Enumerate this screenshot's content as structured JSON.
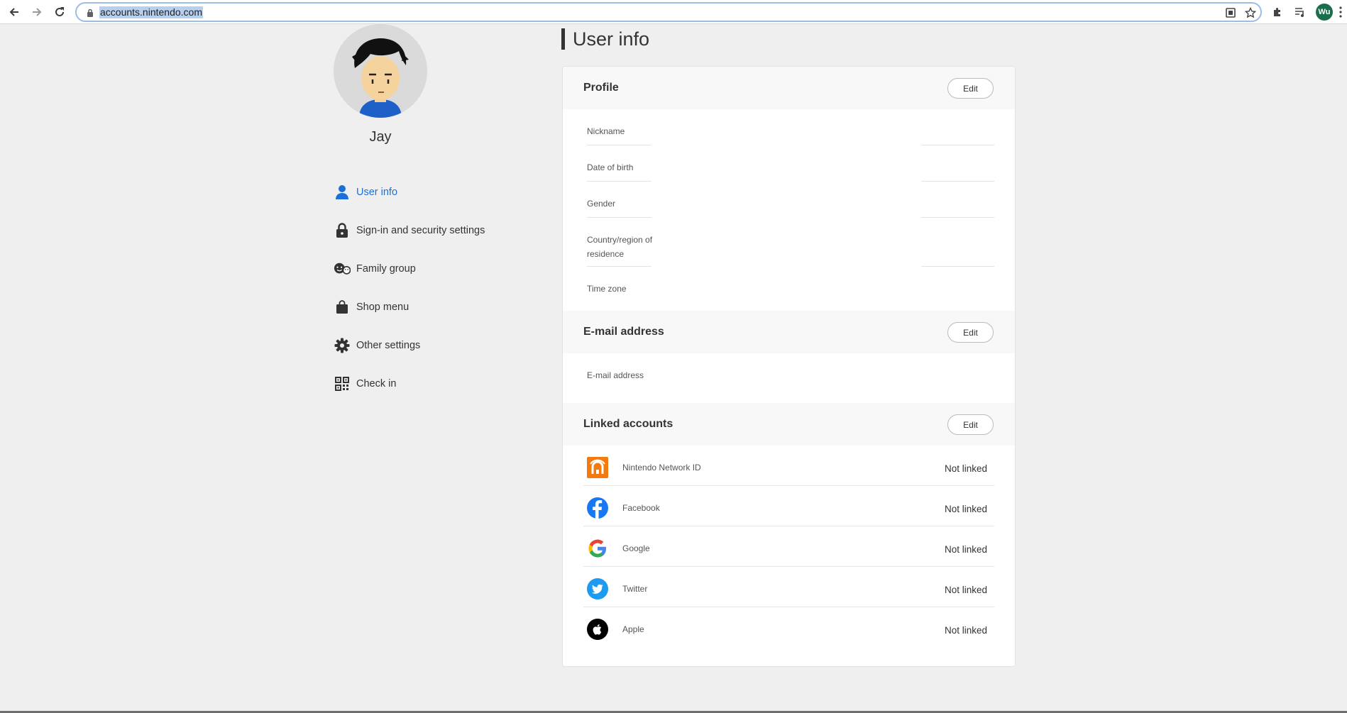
{
  "browser": {
    "url": "accounts.nintendo.com",
    "profile_initials": "Wu"
  },
  "user": {
    "name": "Jay"
  },
  "sidebar": {
    "items": [
      {
        "label": "User info",
        "icon": "user-icon",
        "active": true
      },
      {
        "label": "Sign-in and security settings",
        "icon": "lock-icon",
        "active": false
      },
      {
        "label": "Family group",
        "icon": "family-icon",
        "active": false
      },
      {
        "label": "Shop menu",
        "icon": "shopping-bag-icon",
        "active": false
      },
      {
        "label": "Other settings",
        "icon": "gear-icon",
        "active": false
      },
      {
        "label": "Check in",
        "icon": "qr-code-icon",
        "active": false
      }
    ]
  },
  "main": {
    "title": "User info",
    "profile": {
      "title": "Profile",
      "edit_label": "Edit",
      "fields": [
        "Nickname",
        "Date of birth",
        "Gender",
        "Country/region of residence",
        "Time zone"
      ]
    },
    "email": {
      "title": "E-mail address",
      "edit_label": "Edit",
      "field_label": "E-mail address"
    },
    "linked": {
      "title": "Linked accounts",
      "edit_label": "Edit",
      "accounts": [
        {
          "name": "Nintendo Network ID",
          "status": "Not linked",
          "icon": "nintendo-network-icon"
        },
        {
          "name": "Facebook",
          "status": "Not linked",
          "icon": "facebook-icon"
        },
        {
          "name": "Google",
          "status": "Not linked",
          "icon": "google-icon"
        },
        {
          "name": "Twitter",
          "status": "Not linked",
          "icon": "twitter-icon"
        },
        {
          "name": "Apple",
          "status": "Not linked",
          "icon": "apple-icon"
        }
      ]
    }
  },
  "colors": {
    "accent": "#1c6fd6",
    "page_bg": "#efefef",
    "nintendo": "#f47a0e",
    "facebook": "#1877f2",
    "twitter": "#1d9bf0",
    "apple": "#000000"
  }
}
